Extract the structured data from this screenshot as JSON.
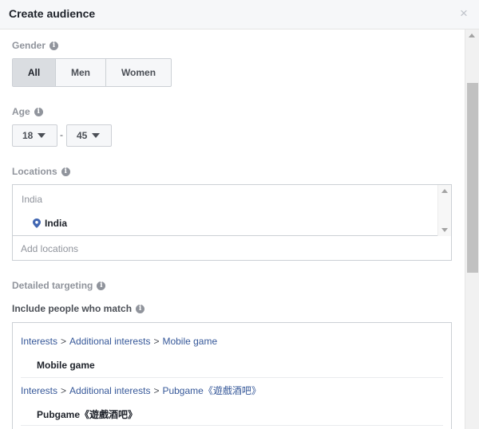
{
  "header": {
    "title": "Create audience",
    "close_glyph": "×"
  },
  "gender": {
    "label": "Gender",
    "options": [
      {
        "label": "All",
        "active": true
      },
      {
        "label": "Men",
        "active": false
      },
      {
        "label": "Women",
        "active": false
      }
    ]
  },
  "age": {
    "label": "Age",
    "min": "18",
    "separator": "-",
    "max": "45"
  },
  "locations": {
    "label": "Locations",
    "group": "India",
    "items": [
      "India"
    ],
    "input_placeholder": "Add locations"
  },
  "detailed_targeting": {
    "label": "Detailed targeting",
    "include_label": "Include people who match",
    "interests": [
      {
        "path": [
          "Interests",
          "Additional interests",
          "Mobile game"
        ],
        "name": "Mobile game"
      },
      {
        "path": [
          "Interests",
          "Additional interests",
          "Pubgame《遊戲酒吧》"
        ],
        "name": "Pubgame《遊戲酒吧》"
      }
    ]
  },
  "icons": {
    "info": "i",
    "path_separator": ">"
  },
  "colors": {
    "link": "#365899",
    "label_gray": "#90949c",
    "border": "#ccd0d5",
    "segment_active": "#dadde1"
  }
}
